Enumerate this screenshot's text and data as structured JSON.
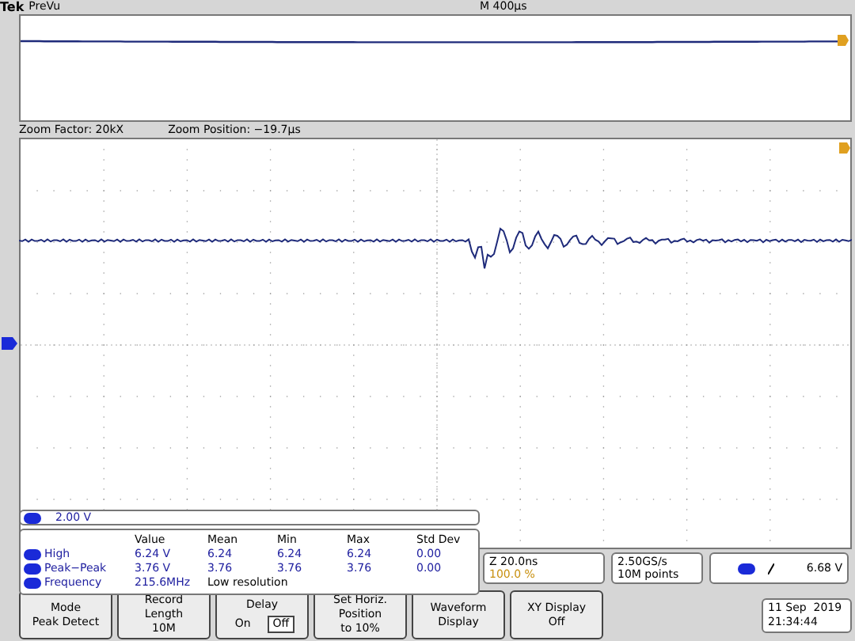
{
  "header": {
    "brand": "Tek",
    "mode": "PreVu",
    "timebase": "M 400µs"
  },
  "zoom": {
    "factor": "Zoom Factor: 20kX",
    "position": "Zoom Position: −19.7µs"
  },
  "channel": {
    "scale": "2.00 V"
  },
  "measurements": {
    "columns": [
      "Value",
      "Mean",
      "Min",
      "Max",
      "Std Dev"
    ],
    "rows": [
      {
        "name": "High",
        "cells": [
          "6.24 V",
          "6.24",
          "6.24",
          "6.24",
          "0.00"
        ]
      },
      {
        "name": "Peak−Peak",
        "cells": [
          "3.76 V",
          "3.76",
          "3.76",
          "3.76",
          "0.00"
        ]
      },
      {
        "name": "Frequency",
        "cells": [
          "215.6MHz",
          "Low resolution"
        ]
      }
    ]
  },
  "horizontal": {
    "scale": "Z 20.0ns",
    "zoom_percent": "100.0 %"
  },
  "acquisition": {
    "rate": "2.50GS/s",
    "points": "10M points"
  },
  "trigger": {
    "level": "6.68 V"
  },
  "buttons": [
    {
      "kind": "label",
      "lines": [
        "Mode",
        "Peak Detect"
      ]
    },
    {
      "kind": "label",
      "lines": [
        "Record",
        "Length",
        "10M"
      ]
    },
    {
      "kind": "toggle",
      "title": "Delay",
      "options": [
        {
          "label": "On",
          "selected": false
        },
        {
          "label": "Off",
          "selected": true
        }
      ]
    },
    {
      "kind": "label",
      "lines": [
        "Set Horiz.",
        "Position",
        "to 10%"
      ]
    },
    {
      "kind": "label",
      "lines": [
        "Waveform",
        "Display"
      ]
    },
    {
      "kind": "label",
      "lines": [
        "XY Display",
        "Off"
      ]
    }
  ],
  "datetime": {
    "date": "11 Sep  2019",
    "time": "21:34:44"
  }
}
